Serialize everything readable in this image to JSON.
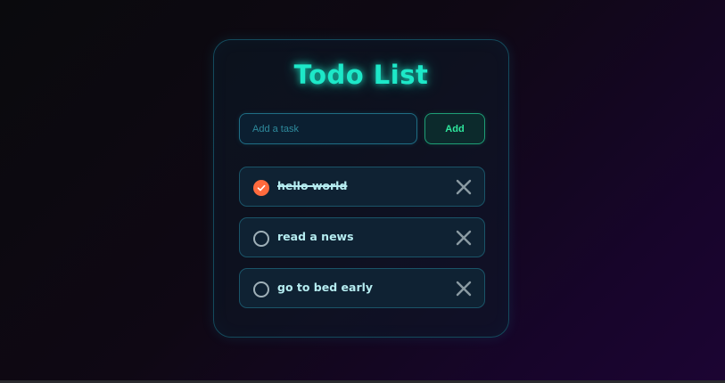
{
  "app": {
    "title": "Todo List"
  },
  "form": {
    "input_value": "",
    "input_placeholder": "Add a task",
    "add_label": "Add"
  },
  "tasks": [
    {
      "text": "hello world",
      "completed": true
    },
    {
      "text": "read a news",
      "completed": false
    },
    {
      "text": "go to bed early",
      "completed": false
    }
  ],
  "icons": {
    "check": "check-icon",
    "delete": "close-icon",
    "unchecked": "circle-icon"
  },
  "colors": {
    "accent": "#1de8c8",
    "add_button": "#2ee89e",
    "completed": "#ff6a3d",
    "task_text": "#b5ecf0"
  }
}
